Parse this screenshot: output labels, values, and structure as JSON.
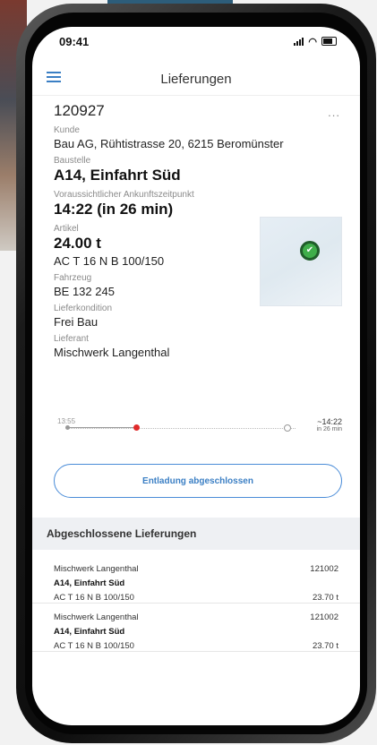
{
  "status": {
    "time": "09:41"
  },
  "header": {
    "title": "Lieferungen"
  },
  "delivery": {
    "id": "120927",
    "more": "...",
    "customer_label": "Kunde",
    "customer": "Bau AG, Rühtistrasse 20, 6215 Beromünster",
    "site_label": "Baustelle",
    "site": "A14, Einfahrt Süd",
    "eta_label": "Voraussichtlicher Ankunftszeitpunkt",
    "eta": "14:22 (in 26 min)",
    "article_label": "Artikel",
    "amount": "24.00 t",
    "article": "AC T 16 N B 100/150",
    "vehicle_label": "Fahrzeug",
    "vehicle": "BE 132 245",
    "condition_label": "Lieferkondition",
    "condition": "Frei Bau",
    "supplier_label": "Lieferant",
    "supplier": "Mischwerk Langenthal"
  },
  "timeline": {
    "start": "13:55",
    "end": "~14:22",
    "end_sub": "in 26 min"
  },
  "action": {
    "label": "Entladung abgeschlossen"
  },
  "completed": {
    "title": "Abgeschlossene Lieferungen",
    "items": [
      {
        "supplier": "Mischwerk Langenthal",
        "id": "121002",
        "site": "A14, Einfahrt Süd",
        "article": "AC T 16 N B 100/150",
        "amount": "23.70 t"
      },
      {
        "supplier": "Mischwerk Langenthal",
        "id": "121002",
        "site": "A14, Einfahrt Süd",
        "article": "AC T 16 N B 100/150",
        "amount": "23.70 t"
      }
    ]
  },
  "colors": {
    "accent": "#3b7fc4",
    "marker": "#e02b2b",
    "pin": "#3fae4a"
  }
}
